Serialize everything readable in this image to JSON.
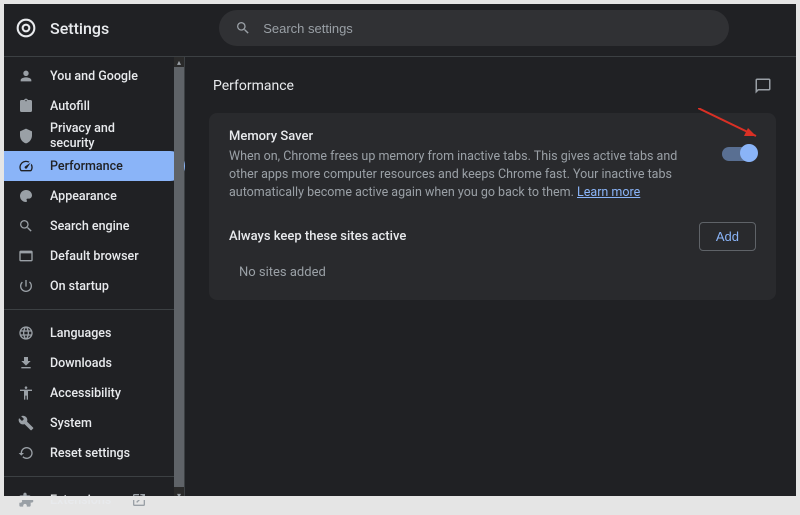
{
  "app_title": "Settings",
  "search": {
    "placeholder": "Search settings"
  },
  "sidebar": {
    "items": [
      {
        "label": "You and Google"
      },
      {
        "label": "Autofill"
      },
      {
        "label": "Privacy and security"
      },
      {
        "label": "Performance"
      },
      {
        "label": "Appearance"
      },
      {
        "label": "Search engine"
      },
      {
        "label": "Default browser"
      },
      {
        "label": "On startup"
      },
      {
        "label": "Languages"
      },
      {
        "label": "Downloads"
      },
      {
        "label": "Accessibility"
      },
      {
        "label": "System"
      },
      {
        "label": "Reset settings"
      },
      {
        "label": "Extensions"
      }
    ]
  },
  "page": {
    "title": "Performance",
    "memory_saver": {
      "title": "Memory Saver",
      "description": "When on, Chrome frees up memory from inactive tabs. This gives active tabs and other apps more computer resources and keeps Chrome fast. Your inactive tabs automatically become active again when you go back to them. ",
      "learn_more": "Learn more",
      "enabled": true
    },
    "keep_active": {
      "title": "Always keep these sites active",
      "add_label": "Add",
      "empty_text": "No sites added"
    }
  },
  "colors": {
    "accent": "#8ab4f8",
    "bg": "#202124",
    "card": "#292a2d",
    "text": "#e8eaed",
    "muted": "#9aa0a6"
  }
}
